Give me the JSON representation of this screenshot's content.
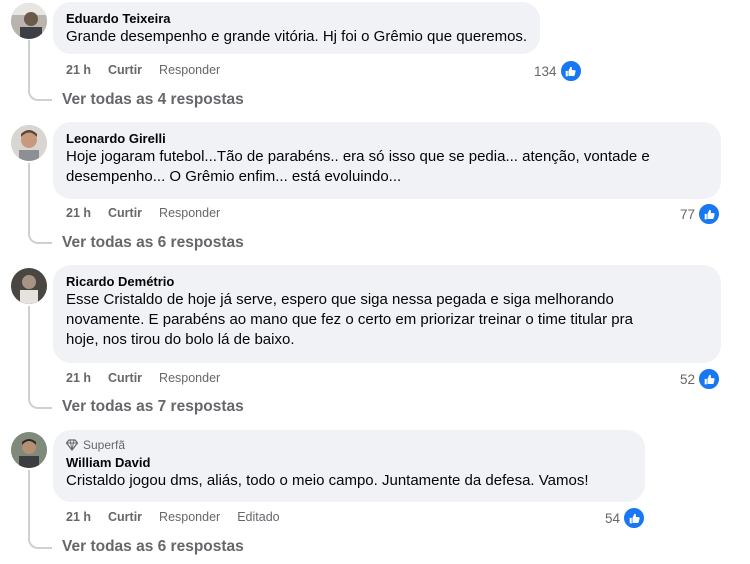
{
  "comments": [
    {
      "author": "Eduardo Teixeira",
      "text": "Grande desempenho e grande vitória. Hj foi o Grêmio que queremos.",
      "time": "21 h",
      "like": "Curtir",
      "reply": "Responder",
      "likes": "134",
      "view_replies": "Ver todas as 4 respostas"
    },
    {
      "author": "Leonardo Girelli",
      "text_lines": [
        "Hoje jogaram futebol...Tão de parabéns.. era só isso que se pedia... atenção, vontade e",
        "desempenho... O Grêmio enfim... está evoluindo..."
      ],
      "time": "21 h",
      "like": "Curtir",
      "reply": "Responder",
      "likes": "77",
      "view_replies": "Ver todas as 6 respostas"
    },
    {
      "author": "Ricardo Demétrio",
      "text_lines": [
        "Esse Cristaldo de hoje já serve, espero que siga nessa pegada e siga melhorando",
        "novamente. E parabéns ao mano que fez o certo em priorizar treinar o time titular pra",
        "hoje, nos tirou do bolo lá de baixo."
      ],
      "time": "21 h",
      "like": "Curtir",
      "reply": "Responder",
      "likes": "52",
      "view_replies": "Ver todas as 7 respostas"
    },
    {
      "badge": "Superfã",
      "author": "William David",
      "text": "Cristaldo jogou dms, aliás, todo o meio campo. Juntamente da defesa. Vamos!",
      "time": "21 h",
      "like": "Curtir",
      "reply": "Responder",
      "edited": "Editado",
      "likes": "54",
      "view_replies": "Ver todas as 6 respostas"
    }
  ],
  "colors": {
    "bubble": "#f0f2f5",
    "like_blue": "#1877f2",
    "secondary_text": "#65676b"
  },
  "icons": {
    "like": "thumbs-up-icon",
    "badge": "diamond-icon"
  }
}
